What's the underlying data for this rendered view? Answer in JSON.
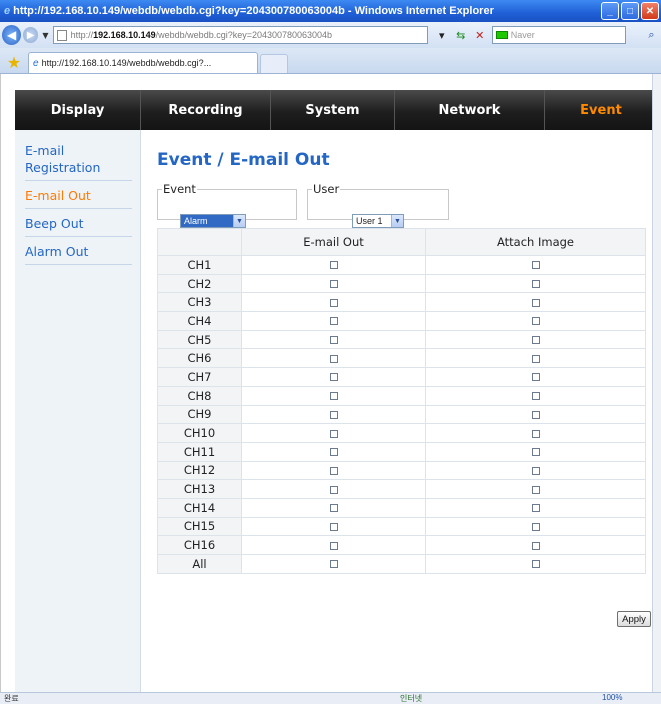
{
  "browser": {
    "title": "http://192.168.10.149/webdb/webdb.cgi?key=204300780063004b - Windows Internet Explorer",
    "address_prefix": "http://",
    "address_host": "192.168.10.149",
    "address_rest": "/webdb/webdb.cgi?key=204300780063004b",
    "search_placeholder": "Naver",
    "tab_title": "http://192.168.10.149/webdb/webdb.cgi?...",
    "status_left": "완료",
    "status_zone": "인터넷",
    "status_zoom": "100%"
  },
  "topnav": {
    "items": [
      "Display",
      "Recording",
      "System",
      "Network",
      "Event"
    ],
    "active": "Event"
  },
  "sidebar": {
    "items": [
      {
        "label": "E-mail Registration",
        "active": false
      },
      {
        "label": "E-mail Out",
        "active": true
      },
      {
        "label": "Beep Out",
        "active": false
      },
      {
        "label": "Alarm Out",
        "active": false
      }
    ]
  },
  "page": {
    "title": "Event / E-mail Out",
    "event_legend": "Event",
    "event_value": "Alarm",
    "user_legend": "User",
    "user_value": "User 1",
    "apply_label": "Apply"
  },
  "table": {
    "headers": [
      "",
      "E-mail Out",
      "Attach Image"
    ],
    "rows": [
      {
        "label": "CH1",
        "email_out": false,
        "attach_image": false
      },
      {
        "label": "CH2",
        "email_out": false,
        "attach_image": false
      },
      {
        "label": "CH3",
        "email_out": false,
        "attach_image": false
      },
      {
        "label": "CH4",
        "email_out": false,
        "attach_image": false
      },
      {
        "label": "CH5",
        "email_out": false,
        "attach_image": false
      },
      {
        "label": "CH6",
        "email_out": false,
        "attach_image": false
      },
      {
        "label": "CH7",
        "email_out": false,
        "attach_image": false
      },
      {
        "label": "CH8",
        "email_out": false,
        "attach_image": false
      },
      {
        "label": "CH9",
        "email_out": false,
        "attach_image": false
      },
      {
        "label": "CH10",
        "email_out": false,
        "attach_image": false
      },
      {
        "label": "CH11",
        "email_out": false,
        "attach_image": false
      },
      {
        "label": "CH12",
        "email_out": false,
        "attach_image": false
      },
      {
        "label": "CH13",
        "email_out": false,
        "attach_image": false
      },
      {
        "label": "CH14",
        "email_out": false,
        "attach_image": false
      },
      {
        "label": "CH15",
        "email_out": false,
        "attach_image": false
      },
      {
        "label": "CH16",
        "email_out": false,
        "attach_image": false
      },
      {
        "label": "All",
        "email_out": false,
        "attach_image": false
      }
    ]
  },
  "colors": {
    "accent_blue": "#2466c4",
    "active_orange": "#ff8a00",
    "nav_bg": "#1e1e1e",
    "sidebar_bg": "#eef3f8"
  }
}
